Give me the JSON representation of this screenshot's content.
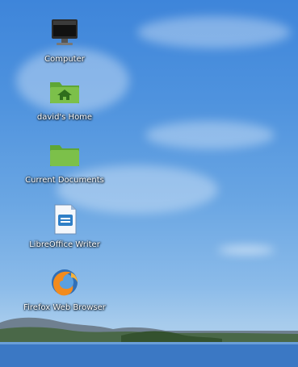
{
  "desktop": {
    "icons": [
      {
        "label": "Computer",
        "icon": "monitor-icon"
      },
      {
        "label": "david's Home",
        "icon": "home-folder-icon"
      },
      {
        "label": "Current Documents",
        "icon": "folder-icon"
      },
      {
        "label": "LibreOffice Writer",
        "icon": "libreoffice-writer-icon"
      },
      {
        "label": "Firefox Web Browser",
        "icon": "firefox-icon"
      }
    ]
  },
  "colors": {
    "folder_green": "#7cc04a",
    "sky_blue": "#4f93de",
    "water_blue": "#3b78c4"
  }
}
